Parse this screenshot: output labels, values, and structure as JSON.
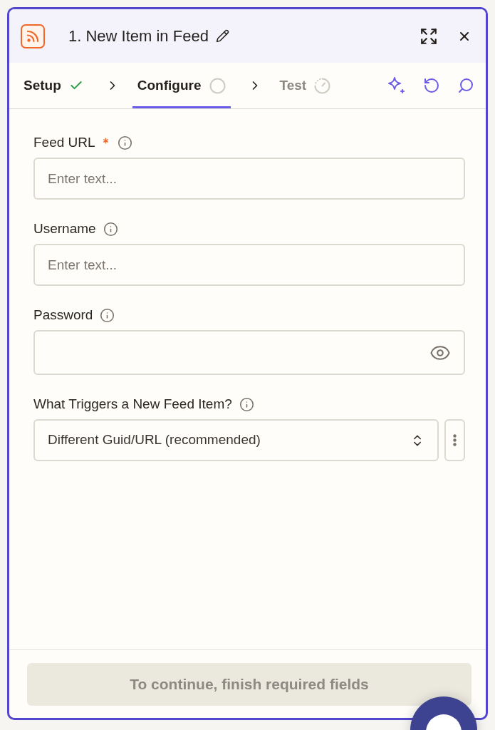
{
  "window": {
    "title": "1. New Item in Feed"
  },
  "steps": [
    {
      "label": "Setup",
      "kind": "done",
      "selected": false,
      "disabled": false
    },
    {
      "label": "Configure",
      "kind": "current",
      "selected": true,
      "disabled": false
    },
    {
      "label": "Test",
      "kind": "waiting",
      "selected": false,
      "disabled": true
    }
  ],
  "fields": [
    {
      "kind": "text",
      "label": "Feed URL",
      "required": true,
      "placeholder": "Enter text..."
    },
    {
      "kind": "text",
      "label": "Username",
      "required": false,
      "placeholder": "Enter text..."
    },
    {
      "kind": "password",
      "label": "Password",
      "required": false
    },
    {
      "kind": "select",
      "label": "What Triggers a New Feed Item?",
      "required": false,
      "value": "Different Guid/URL (recommended)"
    }
  ],
  "footer": {
    "button": {
      "label": "To continue, finish required fields",
      "disabled": true
    }
  }
}
